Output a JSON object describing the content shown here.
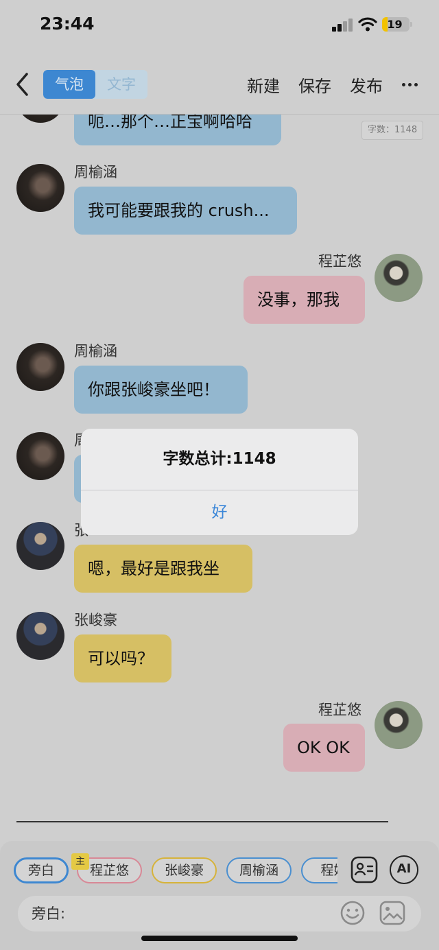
{
  "status_bar": {
    "time": "23:44",
    "battery": "19"
  },
  "nav": {
    "segment_active": "气泡",
    "segment_inactive": "文字",
    "new_label": "新建",
    "save_label": "保存",
    "publish_label": "发布"
  },
  "word_count_badge": "字数：1148",
  "messages": [
    {
      "sender": "",
      "text": "呃…那个…正宝啊哈哈",
      "side": "left"
    },
    {
      "sender": "周榆涵",
      "text": "我可能要跟我的 crush...",
      "side": "left"
    },
    {
      "sender": "程芷悠",
      "text": "没事，那我",
      "side": "right"
    },
    {
      "sender": "周榆涵",
      "text": "你跟张峻豪坐吧！",
      "side": "left"
    },
    {
      "sender": "周",
      "text": "",
      "side": "left"
    },
    {
      "sender": "张",
      "text": "嗯，最好是跟我坐",
      "side": "left"
    },
    {
      "sender": "张峻豪",
      "text": "可以吗？",
      "side": "left"
    },
    {
      "sender": "程芷悠",
      "text": "OK OK",
      "side": "right"
    }
  ],
  "dialog": {
    "title": "字数总计:1148",
    "ok_label": "好"
  },
  "characters": {
    "main_badge": "主",
    "items": [
      {
        "label": "旁白",
        "color": "#3d87d1"
      },
      {
        "label": "程芷悠",
        "color": "#d88896"
      },
      {
        "label": "张峻豪",
        "color": "#d6b33a"
      },
      {
        "label": "周榆涵",
        "color": "#4a8fd0"
      },
      {
        "label": "程妈",
        "color": "#4a8fd0"
      }
    ]
  },
  "ai_label": "AI",
  "input": {
    "label": "旁白:"
  }
}
